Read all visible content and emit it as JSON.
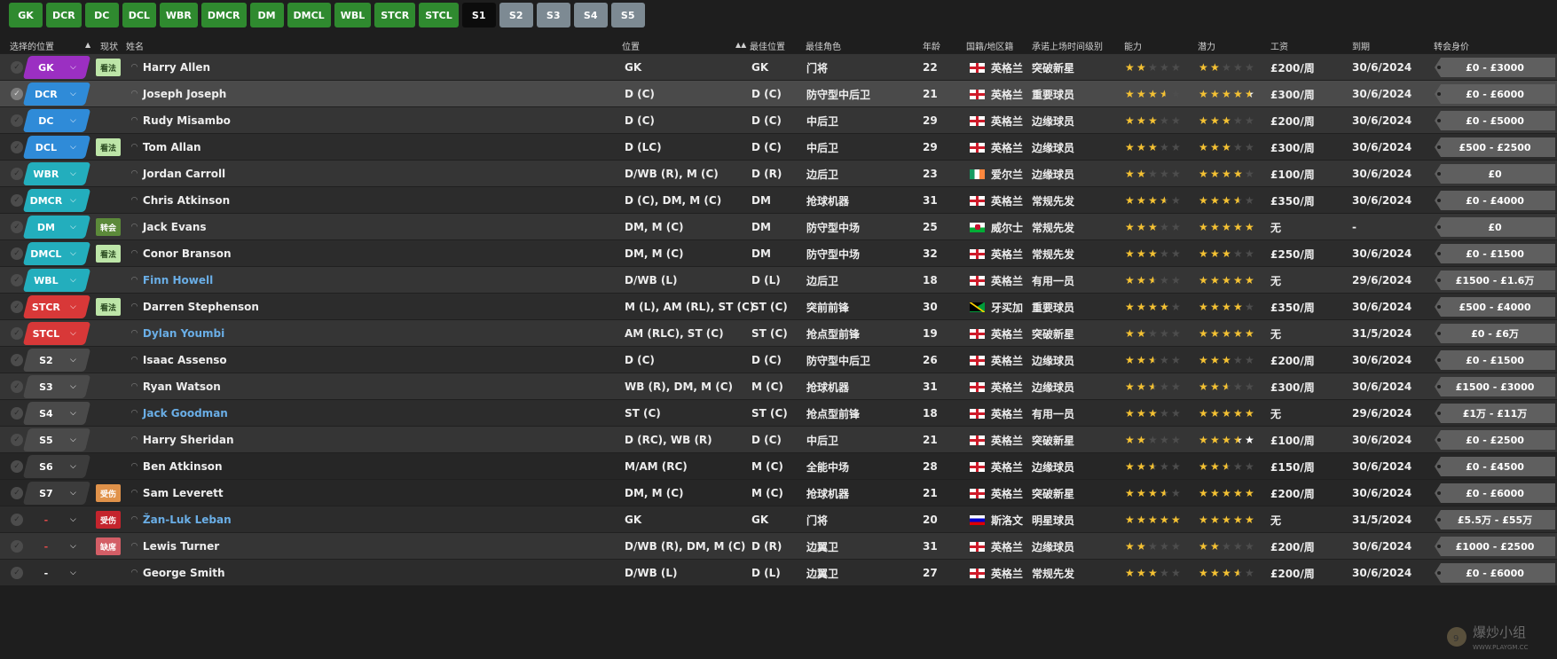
{
  "tabs": [
    {
      "label": "GK",
      "style": "green"
    },
    {
      "label": "DCR",
      "style": "green"
    },
    {
      "label": "DC",
      "style": "green"
    },
    {
      "label": "DCL",
      "style": "green"
    },
    {
      "label": "WBR",
      "style": "green"
    },
    {
      "label": "DMCR",
      "style": "green"
    },
    {
      "label": "DM",
      "style": "green"
    },
    {
      "label": "DMCL",
      "style": "green"
    },
    {
      "label": "WBL",
      "style": "green"
    },
    {
      "label": "STCR",
      "style": "green"
    },
    {
      "label": "STCL",
      "style": "green"
    },
    {
      "label": "S1",
      "style": "black"
    },
    {
      "label": "S2",
      "style": "gray"
    },
    {
      "label": "S3",
      "style": "gray"
    },
    {
      "label": "S4",
      "style": "gray"
    },
    {
      "label": "S5",
      "style": "gray"
    }
  ],
  "headers": {
    "selected_position": "选择的位置",
    "status": "现状",
    "name": "姓名",
    "position": "位置",
    "best_position": "最佳位置",
    "best_role": "最佳角色",
    "age": "年龄",
    "nation": "国籍/地区籍",
    "squad_status": "承诺上场时间级别",
    "ability": "能力",
    "potential": "潜力",
    "wage": "工资",
    "expires": "到期",
    "value": "转会身价"
  },
  "sort_indicators": {
    "selected_position": "▲",
    "position": "▲▲"
  },
  "colors": {
    "tab_green": "#2f8a2f",
    "tab_black": "#0c0c0c",
    "tab_gray": "#7d8a93",
    "star": "#f5c233",
    "name_link": "#6aaee6",
    "gk": "#9b2fc2",
    "def": "#2f8bd8",
    "dm": "#23aebd",
    "att": "#d83838",
    "sub": "#4a4a4a"
  },
  "players": [
    {
      "pos": "GK",
      "pos_color": "#9b2fc2",
      "tag": "看法",
      "tag_color": "#bde5a8",
      "name": "Harry Allen",
      "link": false,
      "position": "GK",
      "best_pos": "GK",
      "role": "门将",
      "age": "22",
      "flag": "en",
      "nation": "英格兰",
      "status": "突破新星",
      "ability": 2,
      "potential": 2,
      "pot_white": false,
      "wage": "£200/周",
      "expires": "30/6/2024",
      "value": "£0 - £3000"
    },
    {
      "pos": "DCR",
      "pos_color": "#2f8bd8",
      "tag": "",
      "tag_color": "",
      "name": "Joseph Joseph",
      "link": false,
      "position": "D (C)",
      "best_pos": "D (C)",
      "role": "防守型中后卫",
      "age": "21",
      "flag": "en",
      "nation": "英格兰",
      "status": "重要球员",
      "ability": 3.5,
      "potential": 4.5,
      "pot_white": true,
      "wage": "£300/周",
      "expires": "30/6/2024",
      "value": "£0 - £6000",
      "selected": true
    },
    {
      "pos": "DC",
      "pos_color": "#2f8bd8",
      "tag": "",
      "tag_color": "",
      "name": "Rudy Misambo",
      "link": false,
      "position": "D (C)",
      "best_pos": "D (C)",
      "role": "中后卫",
      "age": "29",
      "flag": "en",
      "nation": "英格兰",
      "status": "边缘球员",
      "ability": 3,
      "potential": 3,
      "pot_white": false,
      "wage": "£200/周",
      "expires": "30/6/2024",
      "value": "£0 - £5000"
    },
    {
      "pos": "DCL",
      "pos_color": "#2f8bd8",
      "tag": "看法",
      "tag_color": "#bde5a8",
      "name": "Tom Allan",
      "link": false,
      "position": "D (LC)",
      "best_pos": "D (C)",
      "role": "中后卫",
      "age": "29",
      "flag": "en",
      "nation": "英格兰",
      "status": "边缘球员",
      "ability": 3,
      "potential": 3,
      "pot_white": false,
      "wage": "£300/周",
      "expires": "30/6/2024",
      "value": "£500 - £2500"
    },
    {
      "pos": "WBR",
      "pos_color": "#23aebd",
      "tag": "",
      "tag_color": "",
      "name": "Jordan Carroll",
      "link": false,
      "position": "D/WB (R), M (C)",
      "best_pos": "D (R)",
      "role": "边后卫",
      "age": "23",
      "flag": "ie",
      "nation": "爱尔兰",
      "status": "边缘球员",
      "ability": 2,
      "potential": 4,
      "pot_white": false,
      "wage": "£100/周",
      "expires": "30/6/2024",
      "value": "£0"
    },
    {
      "pos": "DMCR",
      "pos_color": "#23aebd",
      "tag": "",
      "tag_color": "",
      "name": "Chris Atkinson",
      "link": false,
      "position": "D (C), DM, M (C)",
      "best_pos": "DM",
      "role": "抢球机器",
      "age": "31",
      "flag": "en",
      "nation": "英格兰",
      "status": "常规先发",
      "ability": 3.5,
      "potential": 3.5,
      "pot_white": false,
      "wage": "£350/周",
      "expires": "30/6/2024",
      "value": "£0 - £4000"
    },
    {
      "pos": "DM",
      "pos_color": "#23aebd",
      "tag": "转会",
      "tag_color": "#5c8a3a",
      "name": "Jack Evans",
      "link": false,
      "position": "DM, M (C)",
      "best_pos": "DM",
      "role": "防守型中场",
      "age": "25",
      "flag": "wl",
      "nation": "威尔士",
      "status": "常规先发",
      "ability": 3,
      "potential": 5,
      "pot_white": false,
      "wage": "无",
      "expires": "-",
      "value": "£0"
    },
    {
      "pos": "DMCL",
      "pos_color": "#23aebd",
      "tag": "看法",
      "tag_color": "#bde5a8",
      "name": "Conor Branson",
      "link": false,
      "position": "DM, M (C)",
      "best_pos": "DM",
      "role": "防守型中场",
      "age": "32",
      "flag": "en",
      "nation": "英格兰",
      "status": "常规先发",
      "ability": 3,
      "potential": 3,
      "pot_white": false,
      "wage": "£250/周",
      "expires": "30/6/2024",
      "value": "£0 - £1500"
    },
    {
      "pos": "WBL",
      "pos_color": "#23aebd",
      "tag": "",
      "tag_color": "",
      "name": "Finn Howell",
      "link": true,
      "position": "D/WB (L)",
      "best_pos": "D (L)",
      "role": "边后卫",
      "age": "18",
      "flag": "en",
      "nation": "英格兰",
      "status": "有用一员",
      "ability": 2.5,
      "potential": 5,
      "pot_white": true,
      "wage": "无",
      "expires": "29/6/2024",
      "value": "£1500 - £1.6万"
    },
    {
      "pos": "STCR",
      "pos_color": "#d83838",
      "tag": "看法",
      "tag_color": "#bde5a8",
      "name": "Darren Stephenson",
      "link": false,
      "position": "M (L), AM (RL), ST (C)",
      "best_pos": "ST (C)",
      "role": "突前前锋",
      "age": "30",
      "flag": "jm",
      "nation": "牙买加",
      "status": "重要球员",
      "ability": 4,
      "potential": 4,
      "pot_white": false,
      "wage": "£350/周",
      "expires": "30/6/2024",
      "value": "£500 - £4000"
    },
    {
      "pos": "STCL",
      "pos_color": "#d83838",
      "tag": "",
      "tag_color": "",
      "name": "Dylan Youmbi",
      "link": true,
      "position": "AM (RLC), ST (C)",
      "best_pos": "ST (C)",
      "role": "抢点型前锋",
      "age": "19",
      "flag": "en",
      "nation": "英格兰",
      "status": "突破新星",
      "ability": 2,
      "potential": 5,
      "pot_white": true,
      "wage": "无",
      "expires": "31/5/2024",
      "value": "£0 - £6万"
    },
    {
      "pos": "S2",
      "pos_color": "#4a4a4a",
      "tag": "",
      "tag_color": "",
      "name": "Isaac Assenso",
      "link": false,
      "position": "D (C)",
      "best_pos": "D (C)",
      "role": "防守型中后卫",
      "age": "26",
      "flag": "en",
      "nation": "英格兰",
      "status": "边缘球员",
      "ability": 2.5,
      "potential": 3,
      "pot_white": false,
      "wage": "£200/周",
      "expires": "30/6/2024",
      "value": "£0 - £1500"
    },
    {
      "pos": "S3",
      "pos_color": "#4a4a4a",
      "tag": "",
      "tag_color": "",
      "name": "Ryan Watson",
      "link": false,
      "position": "WB (R), DM, M (C)",
      "best_pos": "M (C)",
      "role": "抢球机器",
      "age": "31",
      "flag": "en",
      "nation": "英格兰",
      "status": "边缘球员",
      "ability": 2.5,
      "potential": 2.5,
      "pot_white": false,
      "wage": "£300/周",
      "expires": "30/6/2024",
      "value": "£1500 - £3000"
    },
    {
      "pos": "S4",
      "pos_color": "#4a4a4a",
      "tag": "",
      "tag_color": "",
      "name": "Jack Goodman",
      "link": true,
      "position": "ST (C)",
      "best_pos": "ST (C)",
      "role": "抢点型前锋",
      "age": "18",
      "flag": "en",
      "nation": "英格兰",
      "status": "有用一员",
      "ability": 3,
      "potential": 5,
      "pot_white": true,
      "wage": "无",
      "expires": "29/6/2024",
      "value": "£1万 - £11万"
    },
    {
      "pos": "S5",
      "pos_color": "#4a4a4a",
      "tag": "",
      "tag_color": "",
      "name": "Harry Sheridan",
      "link": false,
      "position": "D (RC), WB (R)",
      "best_pos": "D (C)",
      "role": "中后卫",
      "age": "21",
      "flag": "en",
      "nation": "英格兰",
      "status": "突破新星",
      "ability": 2,
      "potential": 3.5,
      "pot_white": true,
      "wage": "£100/周",
      "expires": "30/6/2024",
      "value": "£0 - £2500"
    },
    {
      "pos": "S6",
      "pos_color": "#3c3c3c",
      "tag": "",
      "tag_color": "",
      "name": "Ben Atkinson",
      "link": false,
      "position": "M/AM (RC)",
      "best_pos": "M (C)",
      "role": "全能中场",
      "age": "28",
      "flag": "en",
      "nation": "英格兰",
      "status": "边缘球员",
      "ability": 2.5,
      "potential": 2.5,
      "pot_white": false,
      "wage": "£150/周",
      "expires": "30/6/2024",
      "value": "£0 - £4500",
      "dim": true
    },
    {
      "pos": "S7",
      "pos_color": "#3c3c3c",
      "tag": "受伤",
      "tag_color": "#e0924a",
      "name": "Sam Leverett",
      "link": false,
      "position": "DM, M (C)",
      "best_pos": "M (C)",
      "role": "抢球机器",
      "age": "21",
      "flag": "en",
      "nation": "英格兰",
      "status": "突破新星",
      "ability": 3.5,
      "potential": 5,
      "pot_white": true,
      "wage": "£200/周",
      "expires": "30/6/2024",
      "value": "£0 - £6000",
      "dim": true
    },
    {
      "pos": "-",
      "pos_color": "none",
      "tag": "受伤",
      "tag_color": "#c4242d",
      "name": "Žan-Luk Leban",
      "link": true,
      "position": "GK",
      "best_pos": "GK",
      "role": "门将",
      "age": "20",
      "flag": "si",
      "nation": "斯洛文",
      "status": "明星球员",
      "ability": 5,
      "potential": 5,
      "pot_white": false,
      "wage": "无",
      "expires": "31/5/2024",
      "value": "£5.5万 - £55万",
      "dash_red": true
    },
    {
      "pos": "-",
      "pos_color": "none",
      "tag": "缺席",
      "tag_color": "#d35e66",
      "name": "Lewis Turner",
      "link": false,
      "position": "D/WB (R), DM, M (C)",
      "best_pos": "D (R)",
      "role": "边翼卫",
      "age": "31",
      "flag": "en",
      "nation": "英格兰",
      "status": "边缘球员",
      "ability": 2,
      "potential": 2,
      "pot_white": false,
      "wage": "£200/周",
      "expires": "30/6/2024",
      "value": "£1000 - £2500",
      "dash_red": true
    },
    {
      "pos": "-",
      "pos_color": "none",
      "tag": "",
      "tag_color": "",
      "name": "George Smith",
      "link": false,
      "position": "D/WB (L)",
      "best_pos": "D (L)",
      "role": "边翼卫",
      "age": "27",
      "flag": "en",
      "nation": "英格兰",
      "status": "常规先发",
      "ability": 3,
      "potential": 3.5,
      "pot_white": false,
      "wage": "£200/周",
      "expires": "30/6/2024",
      "value": "£0 - £6000"
    }
  ],
  "watermark": {
    "text": "爆炒小组",
    "url": "WWW.PLAYGM.CC"
  }
}
